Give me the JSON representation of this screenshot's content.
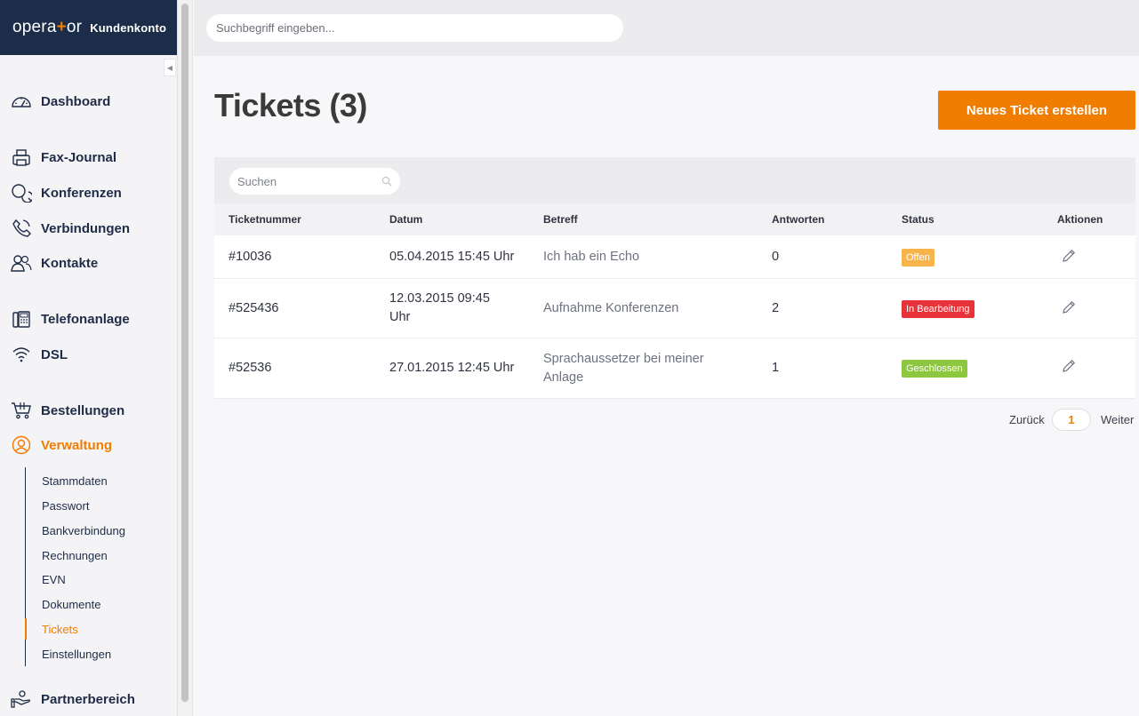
{
  "brand": {
    "logo_left": "opera",
    "logo_plus": "+",
    "logo_right": "or",
    "subtitle": "Kundenkonto"
  },
  "topbar": {
    "search_placeholder": "Suchbegriff eingeben..."
  },
  "sidebar": {
    "items": [
      {
        "label": "Dashboard",
        "icon": "speedometer-icon"
      },
      {
        "label": "Fax-Journal",
        "icon": "fax-icon"
      },
      {
        "label": "Konferenzen",
        "icon": "chat-bubbles-icon"
      },
      {
        "label": "Verbindungen",
        "icon": "phone-icon"
      },
      {
        "label": "Kontakte",
        "icon": "contacts-icon"
      },
      {
        "label": "Telefonanlage",
        "icon": "phone-system-icon"
      },
      {
        "label": "DSL",
        "icon": "wifi-icon"
      },
      {
        "label": "Bestellungen",
        "icon": "cart-icon"
      },
      {
        "label": "Verwaltung",
        "icon": "user-circle-icon",
        "active": true
      },
      {
        "label": "Partnerbereich",
        "icon": "hand-icon"
      }
    ],
    "subitems": [
      "Stammdaten",
      "Passwort",
      "Bankverbindung",
      "Rechnungen",
      "EVN",
      "Dokumente",
      "Tickets",
      "Einstellungen"
    ],
    "active_subitem": "Tickets"
  },
  "main": {
    "title": "Tickets (3)",
    "new_ticket_label": "Neues Ticket erstellen"
  },
  "table": {
    "search_placeholder": "Suchen",
    "columns": [
      "Ticketnummer",
      "Datum",
      "Betreff",
      "Antworten",
      "Status",
      "Aktionen"
    ],
    "rows": [
      {
        "number": "#10036",
        "date": "05.04.2015 15:45 Uhr",
        "subject": "Ich hab ein Echo",
        "replies": "0",
        "status": "Offen",
        "status_color": "#f6b44b"
      },
      {
        "number": "#525436",
        "date": "12.03.2015 09:45 Uhr",
        "subject": "Aufnahme Konferenzen",
        "replies": "2",
        "status": "In Bearbeitung",
        "status_color": "#e8333a"
      },
      {
        "number": "#52536",
        "date": "27.01.2015 12:45 Uhr",
        "subject": "Sprachaussetzer bei meiner Anlage",
        "replies": "1",
        "status": "Geschlossen",
        "status_color": "#8dc63f"
      }
    ]
  },
  "pagination": {
    "prev": "Zurück",
    "current": "1",
    "next": "Weiter"
  },
  "colors": {
    "accent": "#f07d00",
    "brand_bg": "#1c2d4a",
    "nav_text": "#1f2c47"
  }
}
